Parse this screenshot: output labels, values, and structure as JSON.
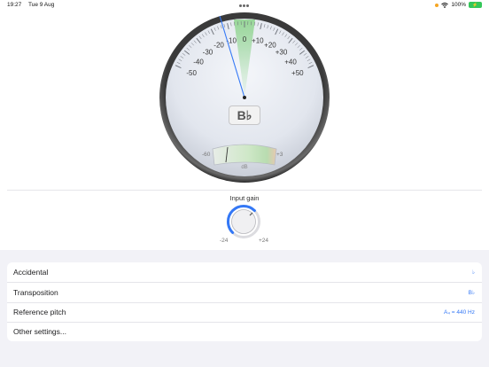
{
  "status_bar": {
    "time": "19:27",
    "date": "Tue 9 Aug",
    "battery": "100%"
  },
  "tuner": {
    "cents_scale": [
      "-50",
      "-40",
      "-30",
      "-20",
      "-10",
      "0",
      "+10",
      "+20",
      "+30",
      "+40",
      "+50"
    ],
    "needle_cents": -13,
    "note": "B♭",
    "level_meter": {
      "min_label": "-60",
      "max_label": "+3",
      "unit_label": "dB"
    }
  },
  "input_gain": {
    "label": "Input gain",
    "min_label": "-24",
    "max_label": "+24"
  },
  "settings": [
    {
      "label": "Accidental",
      "value": "♭"
    },
    {
      "label": "Transposition",
      "value": "B♭"
    },
    {
      "label": "Reference pitch",
      "value": "A₄ = 440 Hz"
    },
    {
      "label": "Other settings...",
      "value": ""
    }
  ],
  "colors": {
    "accent": "#3478f6",
    "tolerance_zone": "#8fd48f",
    "battery": "#34c759"
  }
}
